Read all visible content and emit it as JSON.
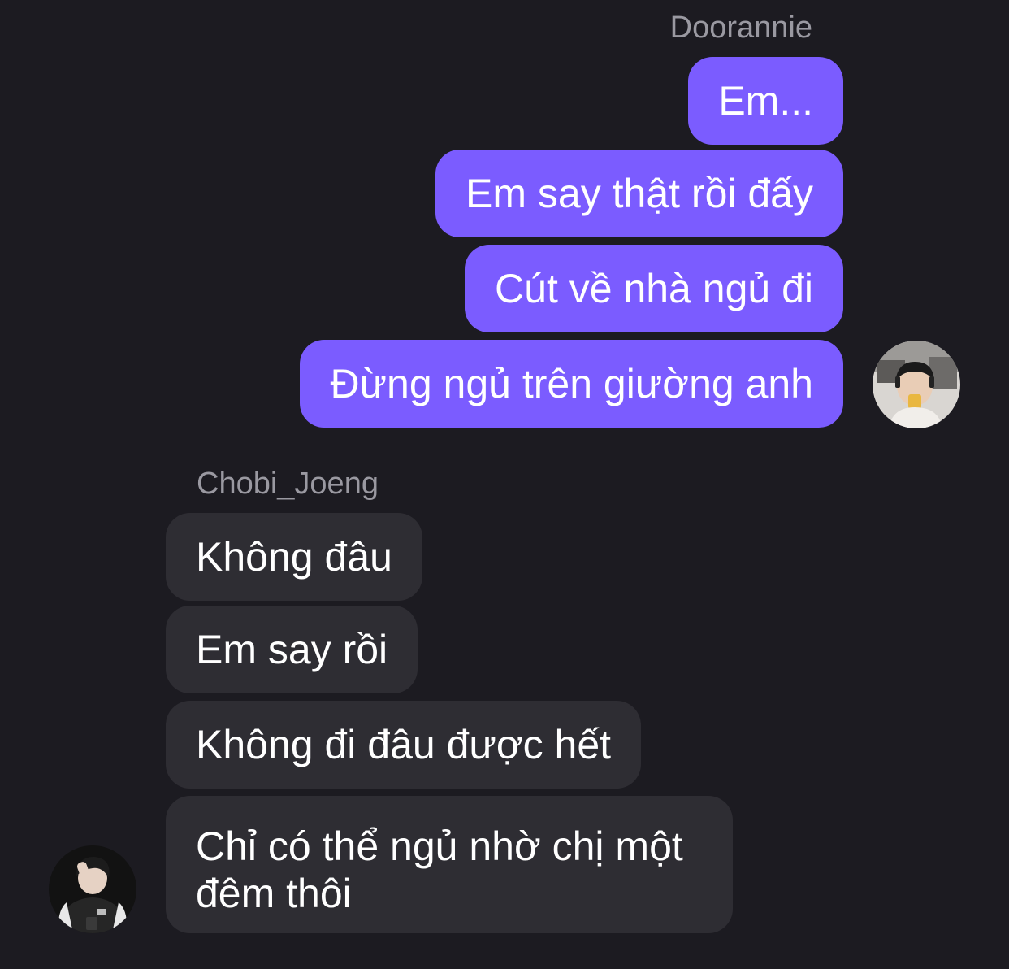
{
  "chat": {
    "outgoing": {
      "sender": "Doorannie",
      "avatar_icon": "user-avatar-icon",
      "bubble_color": "#7b5cff",
      "messages": [
        "Em...",
        "Em say thật rồi đấy",
        "Cút về nhà ngủ đi",
        "Đừng ngủ trên giường anh"
      ]
    },
    "incoming": {
      "sender": "Chobi_Joeng",
      "avatar_icon": "user-avatar-icon",
      "bubble_color": "#2e2d33",
      "messages": [
        "Không đâu",
        "Em say rồi",
        "Không đi đâu được hết",
        "Chỉ có thể ngủ nhờ chị một đêm thôi"
      ]
    },
    "background_color": "#1c1b21",
    "name_color": "#9a99a1"
  }
}
